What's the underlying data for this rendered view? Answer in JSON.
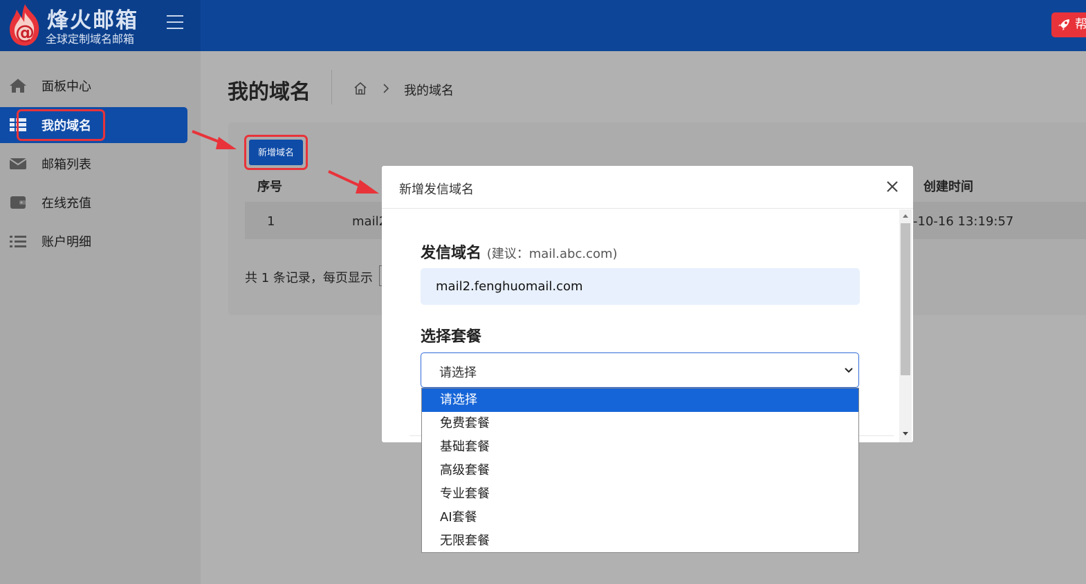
{
  "brand": {
    "title": "烽火邮箱",
    "subtitle": "全球定制域名邮箱",
    "help_label": "帮"
  },
  "sidebar": {
    "items": [
      {
        "label": "面板中心",
        "icon": "home-icon"
      },
      {
        "label": "我的域名",
        "icon": "grid-icon",
        "active": true
      },
      {
        "label": "邮箱列表",
        "icon": "envelope-icon"
      },
      {
        "label": "在线充值",
        "icon": "wallet-icon"
      },
      {
        "label": "账户明细",
        "icon": "list-icon"
      }
    ]
  },
  "page": {
    "title": "我的域名",
    "breadcrumb_current": "我的域名",
    "add_button": "新增域名"
  },
  "table": {
    "headers": [
      "序号",
      "创建时间"
    ],
    "rows": [
      {
        "index": "1",
        "domain_partial": "mail2",
        "created_partial": "-10-16 13:19:57"
      }
    ],
    "pager_text": "共 1 条记录，每页显示"
  },
  "modal": {
    "title": "新增发信域名",
    "domain_label": "发信域名",
    "domain_hint": "(建议：mail.abc.com)",
    "domain_value": "mail2.fenghuomail.com",
    "plan_label": "选择套餐",
    "plan_value": "请选择"
  },
  "dropdown": {
    "options": [
      "请选择",
      "免费套餐",
      "基础套餐",
      "高级套餐",
      "专业套餐",
      "AI套餐",
      "无限套餐"
    ],
    "selected_index": 0
  },
  "colors": {
    "header": "#0d4699",
    "accent": "#0f4ca7",
    "highlight": "#e8333a",
    "option_selected": "#1665d8"
  }
}
